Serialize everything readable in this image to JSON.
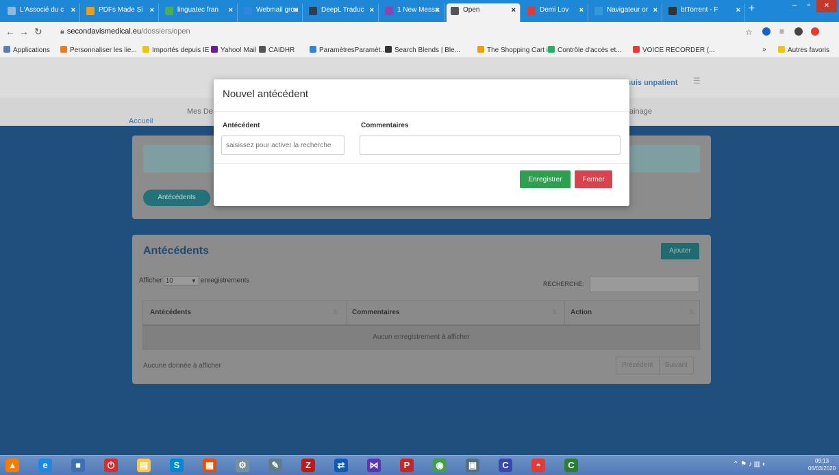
{
  "browser": {
    "tabs": [
      {
        "label": "L'Associé du c",
        "color": "#8fb7e0"
      },
      {
        "label": "PDFs Made Si",
        "color": "#f39c12"
      },
      {
        "label": "linguatec fran",
        "color": "#4caf50"
      },
      {
        "label": "Webmail grou",
        "color": "#2e86de"
      },
      {
        "label": "DeepL Traduc",
        "color": "#2c3e50"
      },
      {
        "label": "1 New Messa",
        "color": "#8e44ad"
      },
      {
        "label": "Open",
        "color": "#555555"
      },
      {
        "label": "Demi Lov",
        "color": "#e53935"
      },
      {
        "label": "Navigateur or",
        "color": "#3498db"
      },
      {
        "label": "btTorrent - F",
        "color": "#333333"
      }
    ],
    "url_host": "secondavismedical.eu",
    "url_path": "/dossiers/open",
    "bookmarks": [
      {
        "label": "Applications",
        "color": "#5b7fb5"
      },
      {
        "label": "Personnaliser les lie...",
        "color": "#e67e22"
      },
      {
        "label": "Importés depuis IE",
        "color": "#f1c40f"
      },
      {
        "label": "Yahoo! Mail",
        "color": "#6a1b9a"
      },
      {
        "label": "CAIDHR",
        "color": "#555555"
      },
      {
        "label": "ParamètresParamèt...",
        "color": "#2e86de"
      },
      {
        "label": "Search Blends | Ble...",
        "color": "#333333"
      },
      {
        "label": "The Shopping Cart i...",
        "color": "#f39c12"
      },
      {
        "label": "Contrôle d'accès et...",
        "color": "#27ae60"
      },
      {
        "label": "VOICE RECORDER (...",
        "color": "#e53935"
      }
    ],
    "other_bookmarks": "Autres favoris"
  },
  "app": {
    "nav": {
      "home": "Accueil",
      "dossiers": "Mes De",
      "right": "ainage"
    },
    "patient_link": "suis unpatient",
    "pill": "Antécédents",
    "section": {
      "title": "Antécédents",
      "add_button": "Ajouter",
      "show_prefix": "Afficher",
      "page_size": "10",
      "show_suffix": "enregistrements",
      "search_label": "RECHERCHE:",
      "columns": [
        "Antécédents",
        "Commentaires",
        "Action"
      ],
      "empty_message": "Aucun enregistrement à afficher",
      "footer": "Aucune donnée à afficher",
      "prev": "Précédent",
      "next": "Suivant"
    }
  },
  "modal": {
    "title": "Nouvel antécédent",
    "antecedent_label": "Antécédent",
    "antecedent_placeholder": "saisissez pour activer la recherche",
    "comment_label": "Commentaires",
    "comment_value": "",
    "save": "Enregistrer",
    "close": "Fermer"
  },
  "taskbar": {
    "time": "09:13",
    "date": "06/03/2020",
    "apps": [
      {
        "name": "vlc-icon",
        "color": "#f57c00",
        "glyph": "▲"
      },
      {
        "name": "ie-icon",
        "color": "#1e88e5",
        "glyph": "e"
      },
      {
        "name": "app-icon",
        "color": "#3f6fb5",
        "glyph": "■"
      },
      {
        "name": "power-icon",
        "color": "#d32f2f",
        "glyph": "⏻"
      },
      {
        "name": "folder-icon",
        "color": "#f9c74f",
        "glyph": "▤"
      },
      {
        "name": "skype-icon",
        "color": "#0288d1",
        "glyph": "S"
      },
      {
        "name": "calendar-icon",
        "color": "#e65100",
        "glyph": "▦"
      },
      {
        "name": "network-icon",
        "color": "#78909c",
        "glyph": "⚙"
      },
      {
        "name": "pen-icon",
        "color": "#607d8b",
        "glyph": "✎"
      },
      {
        "name": "filezilla-icon",
        "color": "#b71c1c",
        "glyph": "Z"
      },
      {
        "name": "teamviewer-icon",
        "color": "#0e5bb5",
        "glyph": "⇄"
      },
      {
        "name": "vs-icon",
        "color": "#5e35b1",
        "glyph": "⋈"
      },
      {
        "name": "p-icon",
        "color": "#c62828",
        "glyph": "P"
      },
      {
        "name": "chrome-icon",
        "color": "#43a047",
        "glyph": "◉"
      },
      {
        "name": "doc-icon",
        "color": "#546e7a",
        "glyph": "▣"
      },
      {
        "name": "c-icon",
        "color": "#3949ab",
        "glyph": "C"
      },
      {
        "name": "app2-icon",
        "color": "#e53935",
        "glyph": "◓"
      },
      {
        "name": "app3-icon",
        "color": "#2e7d32",
        "glyph": "C"
      }
    ]
  }
}
